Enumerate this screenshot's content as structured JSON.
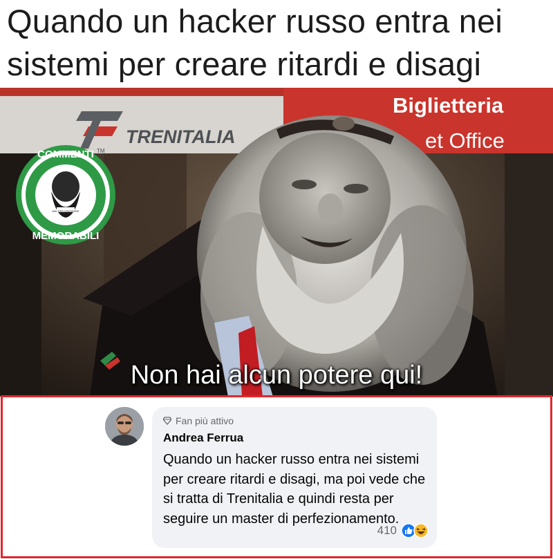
{
  "meme": {
    "title": "Quando un hacker russo entra nei sistemi per creare ritardi e disagi",
    "caption": "Non hai alcun potere qui!",
    "signs": {
      "brand": "TRENITALIA",
      "tm": "TM",
      "ticket_office_line1": "Biglietteria",
      "ticket_office_line2": "et Office"
    },
    "watermark": {
      "top_text": "COMMENTI",
      "bottom_text": "MEMORABILI",
      "small_text": "MAI PER IGNORARE"
    }
  },
  "comment": {
    "badge": "Fan più attivo",
    "author": "Andrea Ferrua",
    "text": "Quando un hacker russo entra nei sistemi per creare ritardi e disagi, ma poi vede che si tratta di Trenitalia e quindi resta per seguire un master di perfezionamento.",
    "reaction_count": "410",
    "reactions": [
      "like-icon",
      "haha-icon"
    ]
  },
  "colors": {
    "frame": "#e3262b",
    "bubble": "#f0f2f5",
    "like": "#1877f2",
    "haha": "#f7b928",
    "sign_red": "#c9342c",
    "watermark_green": "#2e9a46"
  }
}
